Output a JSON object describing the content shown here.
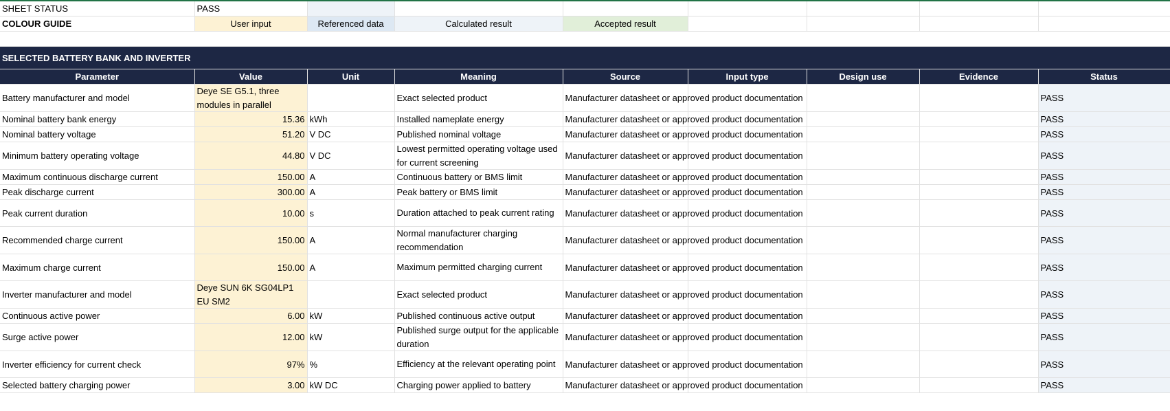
{
  "sheet_status": {
    "label": "SHEET STATUS",
    "value": "PASS"
  },
  "colour_guide": {
    "label": "COLOUR GUIDE",
    "user_input": "User input",
    "referenced_data": "Referenced data",
    "calculated_result": "Calculated result",
    "accepted_result": "Accepted result"
  },
  "colors": {
    "user_input": "#fdf2d4",
    "referenced_data": "#dde8f3",
    "calculated_result": "#eef3f8",
    "accepted_result": "#e1efd9",
    "header_bg": "#1d2744"
  },
  "section_title": "SELECTED BATTERY BANK AND INVERTER",
  "headers": [
    "Parameter",
    "Value",
    "Unit",
    "Meaning",
    "Source",
    "Input type",
    "Design use",
    "Evidence",
    "Status"
  ],
  "rows": [
    {
      "parameter": "Battery manufacturer and model",
      "value": "Deye SE G5.1, three modules in parallel",
      "unit": "",
      "meaning": "Exact selected product",
      "source": "Manufacturer datasheet or approved product documentation",
      "input_type": "",
      "design_use": "",
      "evidence": "",
      "status": "PASS"
    },
    {
      "parameter": "Nominal battery bank energy",
      "value": "15.36",
      "unit": "kWh",
      "meaning": "Installed nameplate energy",
      "source": "Manufacturer datasheet or approved product documentation",
      "input_type": "",
      "design_use": "",
      "evidence": "",
      "status": "PASS"
    },
    {
      "parameter": "Nominal battery voltage",
      "value": "51.20",
      "unit": "V DC",
      "meaning": "Published nominal voltage",
      "source": "Manufacturer datasheet or approved product documentation",
      "input_type": "",
      "design_use": "",
      "evidence": "",
      "status": "PASS"
    },
    {
      "parameter": "Minimum battery operating voltage",
      "value": "44.80",
      "unit": "V DC",
      "meaning": "Lowest permitted operating voltage used for current screening",
      "source": "Manufacturer datasheet or approved product documentation",
      "input_type": "",
      "design_use": "",
      "evidence": "",
      "status": "PASS"
    },
    {
      "parameter": "Maximum continuous discharge current",
      "value": "150.00",
      "unit": "A",
      "meaning": "Continuous battery or BMS limit",
      "source": "Manufacturer datasheet or approved product documentation",
      "input_type": "",
      "design_use": "",
      "evidence": "",
      "status": "PASS"
    },
    {
      "parameter": "Peak discharge current",
      "value": "300.00",
      "unit": "A",
      "meaning": "Peak battery or BMS limit",
      "source": "Manufacturer datasheet or approved product documentation",
      "input_type": "",
      "design_use": "",
      "evidence": "",
      "status": "PASS"
    },
    {
      "parameter": "Peak current duration",
      "value": "10.00",
      "unit": "s",
      "meaning": "Duration attached to peak current rating",
      "source": "Manufacturer datasheet or approved product documentation",
      "input_type": "",
      "design_use": "",
      "evidence": "",
      "status": "PASS"
    },
    {
      "parameter": "Recommended charge current",
      "value": "150.00",
      "unit": "A",
      "meaning": "Normal manufacturer charging recommendation",
      "source": "Manufacturer datasheet or approved product documentation",
      "input_type": "",
      "design_use": "",
      "evidence": "",
      "status": "PASS"
    },
    {
      "parameter": "Maximum charge current",
      "value": "150.00",
      "unit": "A",
      "meaning": "Maximum permitted charging current",
      "source": "Manufacturer datasheet or approved product documentation",
      "input_type": "",
      "design_use": "",
      "evidence": "",
      "status": "PASS"
    },
    {
      "parameter": "Inverter manufacturer and model",
      "value": "Deye SUN 6K SG04LP1 EU SM2",
      "unit": "",
      "meaning": "Exact selected product",
      "source": "Manufacturer datasheet or approved product documentation",
      "input_type": "",
      "design_use": "",
      "evidence": "",
      "status": "PASS"
    },
    {
      "parameter": "Continuous active power",
      "value": "6.00",
      "unit": "kW",
      "meaning": "Published continuous active output",
      "source": "Manufacturer datasheet or approved product documentation",
      "input_type": "",
      "design_use": "",
      "evidence": "",
      "status": "PASS"
    },
    {
      "parameter": "Surge active power",
      "value": "12.00",
      "unit": "kW",
      "meaning": "Published surge output for the applicable duration",
      "source": "Manufacturer datasheet or approved product documentation",
      "input_type": "",
      "design_use": "",
      "evidence": "",
      "status": "PASS"
    },
    {
      "parameter": "Inverter efficiency for current check",
      "value": "97%",
      "unit": "%",
      "meaning": "Efficiency at the relevant operating point",
      "source": "Manufacturer datasheet or approved product documentation",
      "input_type": "",
      "design_use": "",
      "evidence": "",
      "status": "PASS"
    },
    {
      "parameter": "Selected battery charging power",
      "value": "3.00",
      "unit": "kW DC",
      "meaning": "Charging power applied to battery",
      "source": "Manufacturer datasheet or approved product documentation",
      "input_type": "",
      "design_use": "",
      "evidence": "",
      "status": "PASS"
    }
  ]
}
